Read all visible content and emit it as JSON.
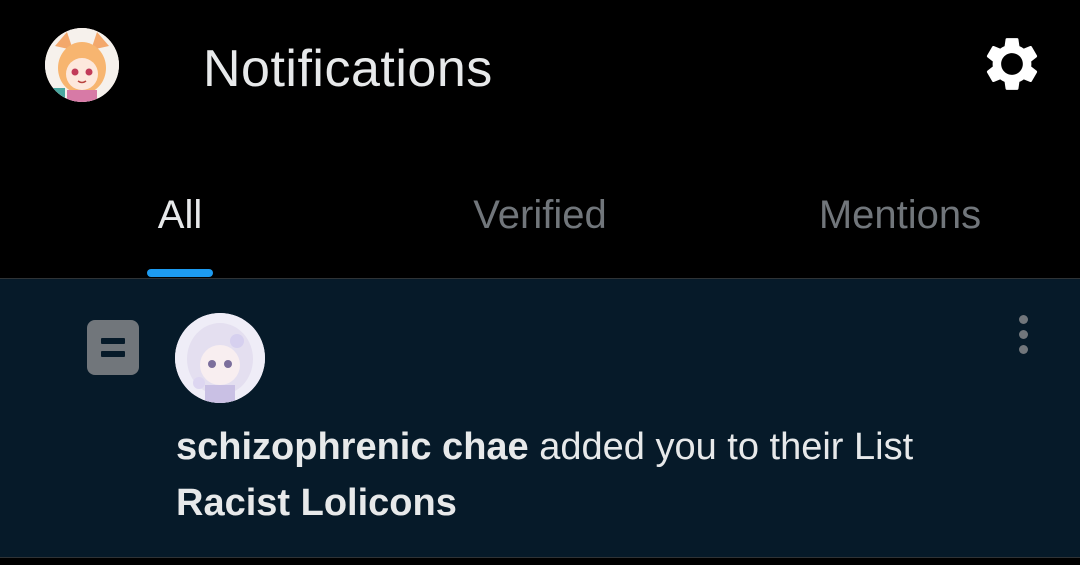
{
  "header": {
    "title": "Notifications",
    "avatar_icon": "profile-avatar",
    "settings_icon": "gear-icon"
  },
  "tabs": [
    {
      "label": "All",
      "active": true
    },
    {
      "label": "Verified",
      "active": false
    },
    {
      "label": "Mentions",
      "active": false
    }
  ],
  "notification": {
    "type_icon": "list-icon",
    "user_name": "schizophrenic chae",
    "action_text": " added you to their List",
    "list_name": "Racist Lolicons",
    "more_icon": "more-vertical-icon"
  },
  "colors": {
    "background": "#000000",
    "accent": "#1d9bf0",
    "unread_background": "#061a29",
    "primary_text": "#e7e9ea",
    "secondary_text": "#71767b"
  }
}
